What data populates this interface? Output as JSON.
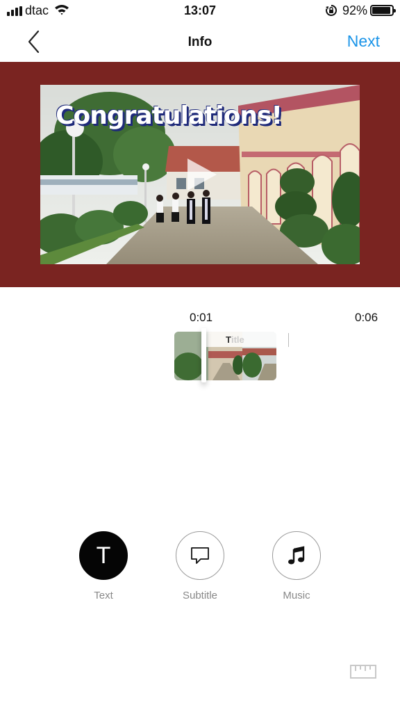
{
  "status_bar": {
    "carrier": "dtac",
    "time": "13:07",
    "battery_percent": "92%",
    "battery_level": 0.92,
    "icons": [
      "signal-icon",
      "wifi-icon",
      "rotation-lock-icon",
      "battery-icon"
    ]
  },
  "nav": {
    "back_icon": "chevron-left-icon",
    "title": "Info",
    "next_label": "Next",
    "accent_color": "#1a94e8"
  },
  "preview": {
    "background_color": "#7a2421",
    "caption": "Congratulations!",
    "play_icon": "play-icon"
  },
  "timeline": {
    "current_time": "0:01",
    "total_time": "0:06",
    "clip_title": "Title",
    "clip_title_initial": "T"
  },
  "tools": {
    "text": {
      "label": "Text",
      "glyph": "T",
      "active": true
    },
    "subtitle": {
      "label": "Subtitle",
      "icon": "speech-bubble-icon"
    },
    "music": {
      "label": "Music",
      "icon": "music-note-icon"
    }
  },
  "footer": {
    "icon": "ruler-icon"
  }
}
